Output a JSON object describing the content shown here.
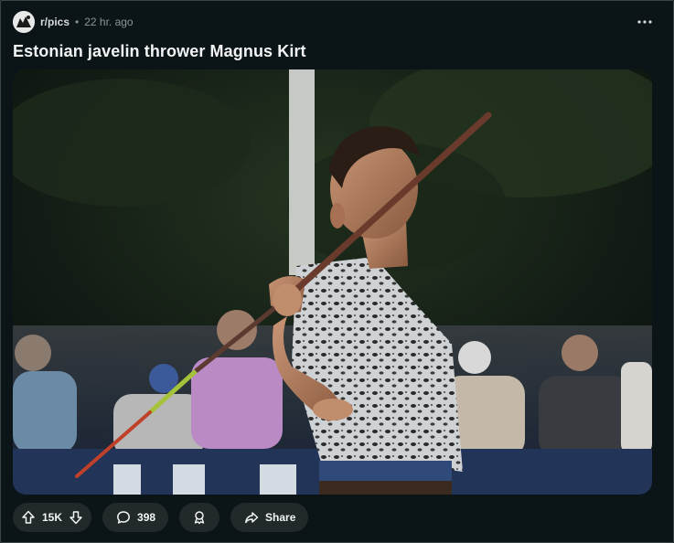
{
  "post": {
    "subreddit": "r/pics",
    "separator": "•",
    "age": "22 hr. ago",
    "title": "Estonian javelin thrower Magnus Kirt"
  },
  "actions": {
    "upvotes": "15K",
    "comments": "398",
    "share_label": "Share"
  },
  "icons": {
    "more": "more-horizontal-icon",
    "upvote": "arrow-up-icon",
    "downvote": "arrow-down-icon",
    "comment": "speech-bubble-icon",
    "award": "award-icon",
    "share": "share-arrow-icon"
  },
  "colors": {
    "background": "#0b1416",
    "pill": "#22292b",
    "text": "#f2f4f5",
    "muted": "#8a9598"
  }
}
